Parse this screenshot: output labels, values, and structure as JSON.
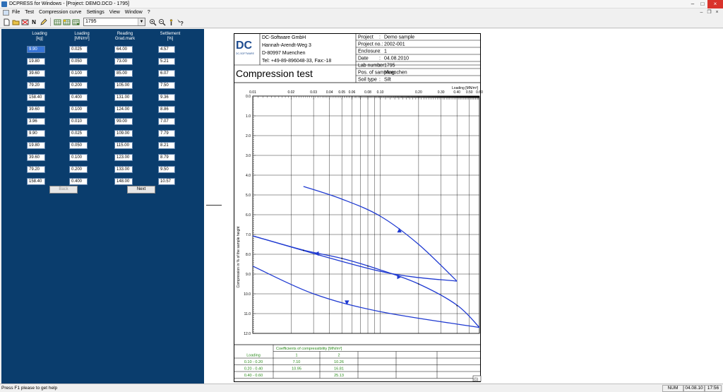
{
  "window": {
    "title": "DCPRESS for Windows - [Project: DEMO.DCD - 1795]",
    "minimize": "–",
    "maximize": "□",
    "close": "×"
  },
  "menu": [
    "File",
    "Test",
    "Compression curve",
    "Settings",
    "View",
    "Window",
    "?"
  ],
  "toolbar": {
    "combo_value": "1795",
    "n_label": "N"
  },
  "left_panel": {
    "headers": [
      {
        "line1": "Loading",
        "line2": "[kg]"
      },
      {
        "line1": "Loading",
        "line2": "[MN/m²]"
      },
      {
        "line1": "Reading",
        "line2": "Grad.mark"
      },
      {
        "line1": "Settlement",
        "line2": "[%]"
      }
    ],
    "rows": [
      [
        "9.90",
        "0.025",
        "64.00",
        "4.57"
      ],
      [
        "19.80",
        "0.050",
        "73.00",
        "5.21"
      ],
      [
        "39.60",
        "0.100",
        "85.00",
        "6.07"
      ],
      [
        "79.20",
        "0.200",
        "105.00",
        "7.50"
      ],
      [
        "158.40",
        "0.400",
        "131.00",
        "9.36"
      ],
      [
        "39.60",
        "0.100",
        "124.00",
        "8.86"
      ],
      [
        "3.96",
        "0.010",
        "99.00",
        "7.07"
      ],
      [
        "9.90",
        "0.025",
        "109.00",
        "7.79"
      ],
      [
        "19.80",
        "0.050",
        "115.00",
        "8.21"
      ],
      [
        "39.60",
        "0.100",
        "123.00",
        "8.79"
      ],
      [
        "79.20",
        "0.200",
        "133.00",
        "9.50"
      ],
      [
        "158.40",
        "0.400",
        "148.00",
        "10.57"
      ]
    ],
    "back_label": "Back",
    "next_label": "Next"
  },
  "report": {
    "company": [
      "DC-Software GmbH",
      "Hannah-Arendt-Weg 3",
      "D-80997 Muenchen",
      "Tel: +49-89-896048-33, Fax:-18"
    ],
    "logo_text": "DC",
    "logo_caption": "DC-SOFTWARE",
    "title": "Compression test",
    "fields": [
      {
        "label": "Project",
        "sep": ":",
        "value": "Demo sample"
      },
      {
        "label": "Project no.:",
        "sep": "",
        "value": "2002-001"
      },
      {
        "label": "Enclosure",
        "sep": ":",
        "value": "1"
      },
      {
        "label": "Date",
        "sep": ":",
        "value": "04.08.2010"
      },
      {
        "label": "Lab number",
        "sep": ":",
        "value": "1795"
      },
      {
        "label": "Pos. of sampling:",
        "sep": "",
        "value": "Muenchen"
      },
      {
        "label": "Soil type",
        "sep": ":",
        "value": "Silt"
      }
    ],
    "coeff_title": "Coefficients of compressibility [MN/m²]",
    "coeff_headers": [
      "Loading",
      "1",
      "2"
    ],
    "coeff_rows": [
      [
        "0.10 - 0.20",
        "7.10",
        "10.26"
      ],
      [
        "0.20 - 0.40",
        "10.95",
        "16.81"
      ],
      [
        "0.40 - 0.60",
        "",
        "25.13"
      ]
    ],
    "page_tag": "(1)"
  },
  "chart_data": {
    "type": "line",
    "xscale": "log",
    "xlim": [
      0.01,
      0.6
    ],
    "ylim": [
      0,
      12
    ],
    "y_inverted": true,
    "xlabel": "Loading [MN/m²]",
    "ylabel": "Compression in % of the sample height",
    "xticks": [
      0.01,
      0.02,
      0.03,
      0.04,
      0.05,
      0.06,
      0.08,
      0.1,
      0.2,
      0.3,
      0.4,
      0.5,
      0.6
    ],
    "xtick_labels": [
      "0.01",
      "0.02",
      "0.03",
      "0.04",
      "0.05",
      "0.06",
      "0.08",
      "0.10",
      "0.20",
      "0.30",
      "0.40",
      "0.50",
      "0.60"
    ],
    "yticks": [
      0,
      1,
      2,
      3,
      4,
      5,
      6,
      7,
      8,
      9,
      10,
      11,
      12
    ],
    "ytick_labels": [
      "0.0",
      "1.0",
      "2.0",
      "3.0",
      "4.0",
      "5.0",
      "6.0",
      "7.0",
      "8.0",
      "9.0",
      "10.0",
      "11.0",
      "12.0"
    ],
    "grid": true,
    "series": [
      {
        "x": [
          0.025,
          0.05,
          0.1,
          0.2,
          0.4
        ],
        "y": [
          4.57,
          5.21,
          6.07,
          7.5,
          9.36
        ],
        "marker": "up"
      },
      {
        "x": [
          0.4,
          0.1,
          0.01
        ],
        "y": [
          9.36,
          8.86,
          7.07
        ],
        "marker": "left"
      },
      {
        "x": [
          0.01,
          0.025,
          0.05,
          0.1,
          0.2,
          0.4,
          0.6
        ],
        "y": [
          7.07,
          7.79,
          8.21,
          8.79,
          9.5,
          10.57,
          11.7
        ],
        "marker": "right"
      },
      {
        "x": [
          0.01,
          0.03,
          0.1,
          0.6
        ],
        "y": [
          8.6,
          10.0,
          10.9,
          11.7
        ],
        "marker": "down"
      }
    ],
    "points": [
      {
        "x": 0.025,
        "y": 7.8
      },
      {
        "x": 0.05,
        "y": 8.2
      },
      {
        "x": 0.08,
        "y": 8.6
      },
      {
        "x": 0.2,
        "y": 9.5
      },
      {
        "x": 0.4,
        "y": 10.6
      }
    ],
    "line_color": "#1f3ad1"
  },
  "status": {
    "help": "Press F1 please to get help",
    "num": "NUM",
    "date": "04.08.10",
    "time": "17:56"
  }
}
